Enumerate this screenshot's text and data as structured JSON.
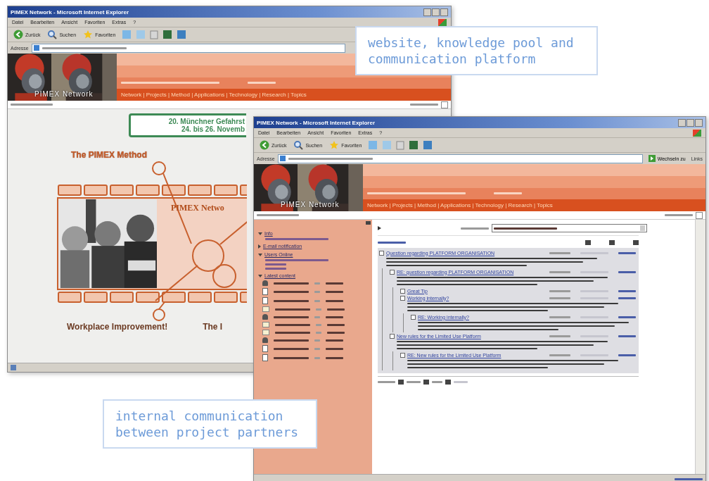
{
  "captions": [
    {
      "text": "website, knowledge pool and communication platform"
    },
    {
      "text": "internal communication between project partners"
    }
  ],
  "back_window": {
    "title": "PIMEX Network - Microsoft Internet Explorer",
    "menu": [
      "Datei",
      "Bearbeiten",
      "Ansicht",
      "Favoriten",
      "Extras",
      "?"
    ],
    "toolbar": [
      {
        "kind": "back",
        "label": "Zurück"
      },
      {
        "kind": "search",
        "label": "Suchen"
      },
      {
        "kind": "favorites",
        "label": "Favoriten"
      }
    ],
    "address_label": "Adresse",
    "logo": "PIMEX Network",
    "nav": "Network | Projects | Method | Applications | Technology | Research | Topics",
    "event": [
      "20. Münchner Gefahrst",
      "24. bis 26. Novemb"
    ],
    "method_title": "The PIMEX Method",
    "strip_label": "PIMEX Netwo",
    "method_caption": "Workplace Improvement!",
    "cut_caption": "The I"
  },
  "front_window": {
    "title": "PIMEX Network - Microsoft Internet Explorer",
    "menu": [
      "Datei",
      "Bearbeiten",
      "Ansicht",
      "Favoriten",
      "Extras",
      "?"
    ],
    "toolbar": [
      {
        "kind": "back",
        "label": "Zurück"
      },
      {
        "kind": "search",
        "label": "Suchen"
      },
      {
        "kind": "favorites",
        "label": "Favoriten"
      }
    ],
    "address_label": "Adresse",
    "go_label": "Wechseln zu",
    "links_label": "Links",
    "logo": "PIMEX Network",
    "nav": "Network | Projects | Method | Applications | Technology | Research | Topics",
    "sidebar": [
      {
        "heading": "Info",
        "expanded": true
      },
      {
        "heading": "E-mail notification",
        "expanded": false
      },
      {
        "heading": "Users Online",
        "expanded": true
      },
      {
        "heading": "Latest content",
        "expanded": true
      }
    ],
    "latest_content": [
      {
        "kind": "user"
      },
      {
        "kind": "doc"
      },
      {
        "kind": "doc"
      },
      {
        "kind": "folder"
      },
      {
        "kind": "user"
      },
      {
        "kind": "folder"
      },
      {
        "kind": "folder"
      },
      {
        "kind": "user"
      },
      {
        "kind": "doc"
      },
      {
        "kind": "doc"
      }
    ],
    "threads": [
      {
        "subject": "Question regarding PLATFORM ORGANISATION",
        "has_body": true,
        "children": [
          {
            "subject": "RE: question regarding PLATFORM ORGANISATION",
            "has_body": true,
            "children": [
              {
                "subject": "Great Tip",
                "has_body": false
              },
              {
                "subject": "Working internally?",
                "has_body": true,
                "children": [
                  {
                    "subject": "RE: Working internally?",
                    "has_body": true
                  }
                ]
              }
            ]
          },
          {
            "subject": "New rules for the Limited Use Platform",
            "has_body": true,
            "children": [
              {
                "subject": "RE: New rules for the Limited Use Platform",
                "has_body": true
              }
            ]
          }
        ]
      }
    ]
  }
}
